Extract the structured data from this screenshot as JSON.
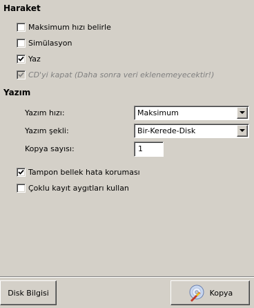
{
  "sections": {
    "action": {
      "title": "Haraket",
      "options": [
        {
          "label": "Maksimum hızı belirle",
          "checked": false,
          "enabled": true
        },
        {
          "label": "Simülasyon",
          "checked": false,
          "enabled": true
        },
        {
          "label": "Yaz",
          "checked": true,
          "enabled": true
        },
        {
          "label": "CD'yi kapat (Daha sonra veri eklenemeyecektir!)",
          "checked": true,
          "enabled": false
        }
      ]
    },
    "writing": {
      "title": "Yazım",
      "speed_label": "Yazım hızı:",
      "speed_value": "Maksimum",
      "mode_label": "Yazım şekli:",
      "mode_value": "Bir-Kerede-Disk",
      "copies_label": "Kopya sayısı:",
      "copies_value": "1",
      "options": [
        {
          "label": "Tampon bellek hata koruması",
          "checked": true,
          "enabled": true
        },
        {
          "label": "Çoklu kayıt aygıtları kullan",
          "checked": false,
          "enabled": true
        }
      ]
    }
  },
  "footer": {
    "disk_info_label": "Disk Bilgisi",
    "copy_label": "Kopya"
  },
  "colors": {
    "window_bg": "#d4d0c8",
    "disabled_text": "#808080"
  },
  "icons": {
    "checkbox_mark": "check-mark-icon",
    "combo_arrow": "chevron-down-icon",
    "copy_button": "disc-burn-icon"
  }
}
